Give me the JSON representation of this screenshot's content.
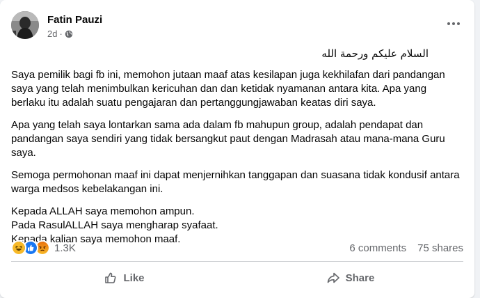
{
  "post": {
    "author": "Fatin Pauzi",
    "time": "2d",
    "greeting": "السلام عليكم ورحمة الله",
    "paragraphs": [
      "Saya pemilik bagi fb ini, memohon jutaan maaf atas kesilapan juga kekhilafan dari pandangan saya yang telah menimbulkan kericuhan dan dan ketidak nyamanan antara kita. Apa yang berlaku itu adalah suatu pengajaran dan pertanggungjawaban keatas diri saya.",
      "Apa yang telah saya lontarkan sama ada dalam fb mahupun group, adalah pendapat dan pandangan saya sendiri yang tidak bersangkut paut dengan Madrasah atau mana-mana Guru saya.",
      "Semoga permohonan maaf ini dapat menjernihkan tanggapan dan suasana tidak kondusif antara warga medsos kebelakangan ini."
    ],
    "closing": [
      "Kepada ALLAH saya memohon ampun.",
      "Pada RasulALLAH saya mengharap syafaat.",
      "Kepada kalian saya memohon maaf."
    ]
  },
  "stats": {
    "reaction_count": "1.3K",
    "comments": "6 comments",
    "shares": "75 shares"
  },
  "actions": {
    "like": "Like",
    "share": "Share"
  },
  "icons": [
    "haha-reaction-icon",
    "like-reaction-icon",
    "angry-reaction-icon",
    "globe-icon",
    "more-options-icon",
    "like-icon",
    "share-icon"
  ],
  "colors": {
    "like_blue": "#1877f2",
    "haha_yellow": "#f7b928",
    "angry_orange": "#e9710f",
    "text_primary": "#050505",
    "text_secondary": "#65676b"
  }
}
